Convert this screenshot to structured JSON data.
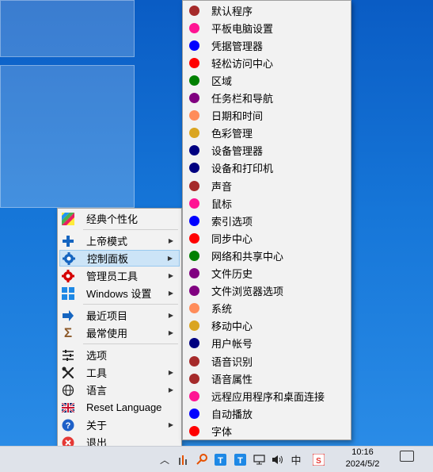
{
  "main_menu": {
    "items": [
      {
        "label": "经典个性化",
        "icon": "rainbow-icon",
        "arrow": false
      },
      {
        "label": "上帝模式",
        "icon": "plus-icon",
        "arrow": true
      },
      {
        "label": "控制面板",
        "icon": "gear-icon",
        "arrow": true
      },
      {
        "label": "管理员工具",
        "icon": "red-gear-icon",
        "arrow": true
      },
      {
        "label": "Windows 设置",
        "icon": "windows-icon",
        "arrow": true
      },
      {
        "label": "最近项目",
        "icon": "arrow-right-icon",
        "arrow": true
      },
      {
        "label": "最常使用",
        "icon": "sigma-icon",
        "arrow": true
      },
      {
        "label": "选项",
        "icon": "sliders-icon",
        "arrow": false
      },
      {
        "label": "工具",
        "icon": "tools-icon",
        "arrow": true
      },
      {
        "label": "语言",
        "icon": "globe-icon",
        "arrow": true
      },
      {
        "label": "Reset Language",
        "icon": "uk-flag-icon",
        "arrow": false
      },
      {
        "label": "关于",
        "icon": "help-icon",
        "arrow": true
      },
      {
        "label": "退出",
        "icon": "close-icon",
        "arrow": false
      }
    ]
  },
  "control_panel_menu": {
    "items": [
      {
        "label": "默认程序",
        "color": "#a52a2a"
      },
      {
        "label": "平板电脑设置",
        "color": "#ff1493"
      },
      {
        "label": "凭据管理器",
        "color": "#0000ff"
      },
      {
        "label": "轻松访问中心",
        "color": "#ff0000"
      },
      {
        "label": "区域",
        "color": "#008000"
      },
      {
        "label": "任务栏和导航",
        "color": "#800080"
      },
      {
        "label": "日期和时间",
        "color": "#ff8c5a"
      },
      {
        "label": "色彩管理",
        "color": "#daa520"
      },
      {
        "label": "设备管理器",
        "color": "#000080"
      },
      {
        "label": "设备和打印机",
        "color": "#000080"
      },
      {
        "label": "声音",
        "color": "#a52a2a"
      },
      {
        "label": "鼠标",
        "color": "#ff1493"
      },
      {
        "label": "索引选项",
        "color": "#0000ff"
      },
      {
        "label": "同步中心",
        "color": "#ff0000"
      },
      {
        "label": "网络和共享中心",
        "color": "#008000"
      },
      {
        "label": "文件历史",
        "color": "#800080"
      },
      {
        "label": "文件浏览器选项",
        "color": "#800080"
      },
      {
        "label": "系统",
        "color": "#ff8c5a"
      },
      {
        "label": "移动中心",
        "color": "#daa520"
      },
      {
        "label": "用户帐号",
        "color": "#000080"
      },
      {
        "label": "语音识别",
        "color": "#a52a2a"
      },
      {
        "label": "语音属性",
        "color": "#a52a2a"
      },
      {
        "label": "远程应用程序和桌面连接",
        "color": "#ff1493"
      },
      {
        "label": "自动播放",
        "color": "#0000ff"
      },
      {
        "label": "字体",
        "color": "#ff0000"
      }
    ]
  },
  "taskbar": {
    "time": "10:16",
    "date": "2024/5/2",
    "ime": "中",
    "tray_icons": [
      "chevron-up-icon",
      "equalizer-icon",
      "key-icon",
      "t-app-icon",
      "t-app2-icon",
      "network-icon",
      "volume-icon"
    ]
  }
}
